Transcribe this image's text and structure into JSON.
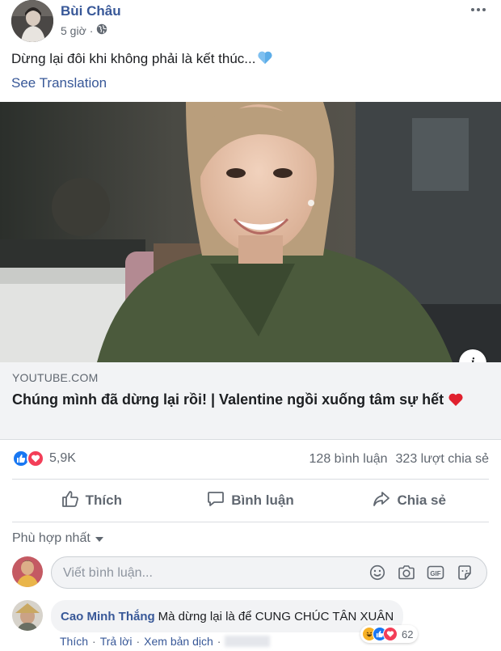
{
  "post": {
    "author": "Bùi Châu",
    "time": "5 giờ",
    "time_separator": "·",
    "audience_icon": "globe-icon",
    "status_text": "Dừng lại đôi khi không phải là kết thúc...",
    "status_emoji": "blue-heart-icon",
    "see_translation": "See Translation"
  },
  "link": {
    "domain": "YOUTUBE.COM",
    "title": "Chúng mình đã dừng lại rồi! | Valentine ngồi xuống tâm sự hết",
    "title_emoji": "red-heart-icon",
    "info_label": "i"
  },
  "reactions": {
    "types": [
      "like-reaction-icon",
      "love-reaction-icon"
    ],
    "count": "5,9K",
    "comments": "128 bình luận",
    "shares": "323 lượt chia sẻ"
  },
  "actions": {
    "like": "Thích",
    "comment": "Bình luận",
    "share": "Chia sẻ"
  },
  "comments": {
    "sort_label": "Phù hợp nhất",
    "composer_placeholder": "Viết bình luận...",
    "composer_icons": [
      "emoji-icon",
      "camera-icon",
      "gif-icon",
      "sticker-icon"
    ],
    "items": [
      {
        "name": "Cao Minh Thắng",
        "text": "Mà dừng lại là để CUNG CHÚC TÂN XUÂN",
        "reaction_count": "62",
        "like_label": "Thích",
        "reply_label": "Trả lời",
        "translate_label": "Xem bản dịch",
        "separator": "·"
      }
    ]
  },
  "colors": {
    "link_blue": "#385898",
    "like_blue": "#1877f2",
    "love_red": "#f33e58",
    "muted": "#606770"
  }
}
